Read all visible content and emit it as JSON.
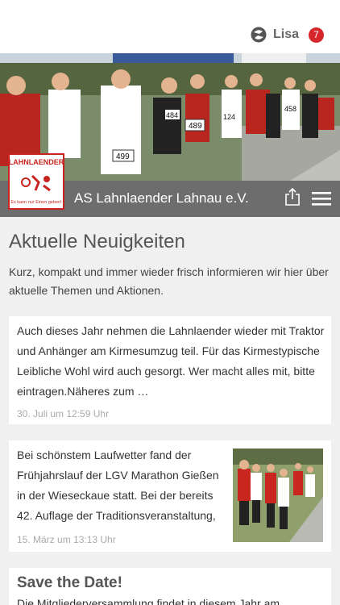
{
  "header": {
    "user_name": "Lisa",
    "notification_count": "7",
    "user_icon": "profile-swirl-icon"
  },
  "club": {
    "name": "AS Lahnlaender Lahnau e.V.",
    "logo_text_top": "LAHNLAENDER",
    "logo_text_bottom": "Es kann nur Einen geben!",
    "share_icon": "share-icon",
    "menu_icon": "hamburger-menu-icon"
  },
  "hero": {
    "bib_numbers": [
      "499",
      "489",
      "124",
      "484",
      "458"
    ]
  },
  "news": {
    "title": "Aktuelle Neuigkeiten",
    "intro": "Kurz, kompakt und immer wieder frisch informieren wir hier über aktuelle Themen und Aktionen.",
    "items": [
      {
        "text": "Auch dieses Jahr nehmen die Lahnlaender wieder mit Traktor und Anhänger am Kirmesumzug teil. Für das Kirmestypische Leibliche Wohl wird auch gesorgt. Wer macht alles mit, bitte eintragen.Näheres zum …",
        "date": "30. Juli um 12:59 Uhr"
      },
      {
        "text": "Bei schönstem Laufwetter fand der Frühjahrslauf der LGV Marathon Gießen in der Wieseckaue statt. Bei der bereits 42. Auflage der Traditionsveranstaltung,",
        "date": "15. März um 13:13 Uhr"
      },
      {
        "title": "Save the Date!",
        "text": "Die Mitgliederversammlung findet in diesem Jahr am"
      }
    ]
  },
  "colors": {
    "accent_red": "#d6262b",
    "club_bar": "#6d6d6d",
    "background": "#f0f0f0"
  }
}
